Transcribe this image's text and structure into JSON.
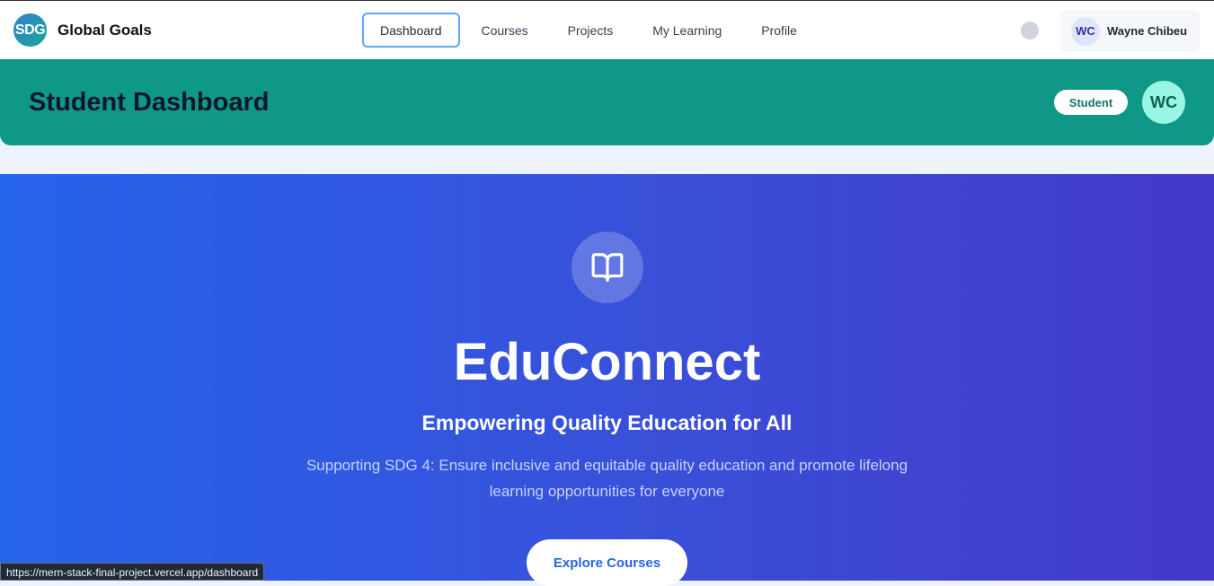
{
  "brand": {
    "logo_text": "SDG",
    "name": "Global Goals"
  },
  "nav": {
    "items": [
      {
        "label": "Dashboard",
        "active": true
      },
      {
        "label": "Courses"
      },
      {
        "label": "Projects"
      },
      {
        "label": "My Learning"
      },
      {
        "label": "Profile"
      }
    ]
  },
  "user": {
    "initials": "WC",
    "name": "Wayne Chibeu"
  },
  "header": {
    "title": "Student Dashboard",
    "role": "Student",
    "initials": "WC"
  },
  "hero": {
    "icon": "book-open-icon",
    "title": "EduConnect",
    "subtitle": "Empowering Quality Education for All",
    "description": "Supporting SDG 4: Ensure inclusive and equitable quality education and promote lifelong learning opportunities for everyone",
    "cta": "Explore Courses"
  },
  "status_bar": {
    "url": "https://mern-stack-final-project.vercel.app/dashboard"
  },
  "colors": {
    "header_teal": "#0f9788",
    "hero_start": "#2563eb",
    "hero_end": "#4338ca",
    "accent_blue": "#60a5fa"
  }
}
